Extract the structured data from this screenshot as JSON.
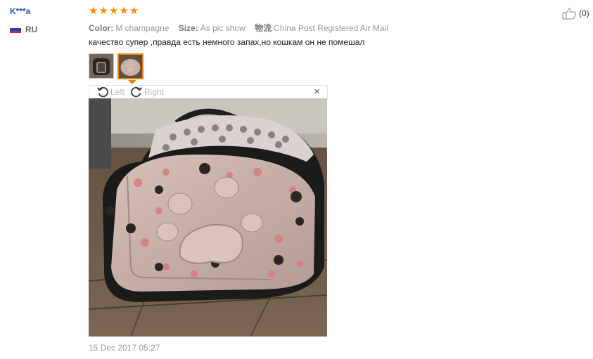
{
  "review": {
    "user_name": "K***a",
    "country_code": "RU",
    "rating": 5,
    "specs": {
      "color_label": "Color:",
      "color_value": "M champagne",
      "size_label": "Size:",
      "size_value": "As pic show",
      "shipping_label": "物流",
      "shipping_value": "China Post Registered Air Mail"
    },
    "text": "качество супер ,правда есть немного запах,но кошкам он не помешал",
    "viewer": {
      "left_label": "Left",
      "right_label": "Right",
      "close_label": "×"
    },
    "date": "15 Dec 2017 05:27",
    "helpful_count": "(0)"
  },
  "colors": {
    "star": "#ff8a00",
    "user_link": "#1a5cb3",
    "active_thumb_border": "#e7830f"
  }
}
